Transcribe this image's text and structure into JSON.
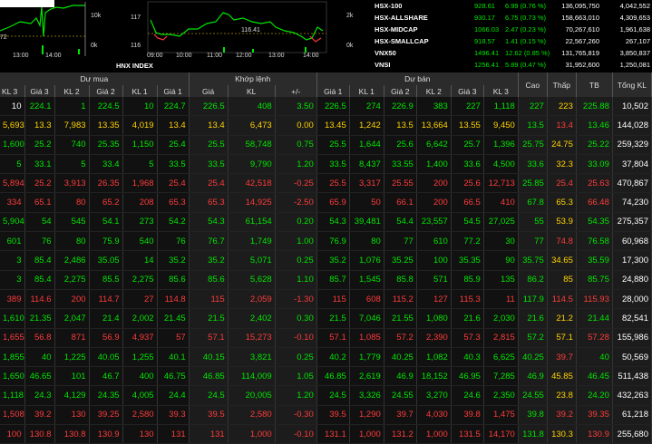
{
  "colors": {
    "up": "#00e600",
    "down": "#ff3b3b",
    "ref": "#ffd400",
    "ceil": "#ff4df0",
    "floor": "#3ee8ff",
    "header_bg": "#2b2b2b"
  },
  "chart1": {
    "y_labels": [
      "10k",
      "0k"
    ],
    "left_text": "72",
    "x_labels": [
      "13:00",
      "14:00"
    ]
  },
  "chart2": {
    "y_left": [
      "117",
      "116"
    ],
    "y_right": [
      "2k",
      "0k"
    ],
    "mid_label": "116.41",
    "x_labels": [
      "09:00",
      "10:00",
      "11:00",
      "12:00",
      "13:00",
      "14:00"
    ],
    "title": "HNX INDEX"
  },
  "indices": [
    {
      "name": "HSX-100",
      "value": "928.61",
      "change": "6.99 (0.76 %)",
      "vol": "136,095,750",
      "val": "4,042,552"
    },
    {
      "name": "HSX-ALLSHARE",
      "value": "930.17",
      "change": "6.75 (0.73 %)",
      "vol": "158,663,010",
      "val": "4,309,653"
    },
    {
      "name": "HSX-MIDCAP",
      "value": "1066.03",
      "change": "2.47 (0.23 %)",
      "vol": "70,267,610",
      "val": "1,961,638"
    },
    {
      "name": "HSX-SMALLCAP",
      "value": "918.57",
      "change": "1.41 (0.15 %)",
      "vol": "22,567,260",
      "val": "267,107"
    },
    {
      "name": "VNX50",
      "value": "1496.41",
      "change": "12.62 (0.85 %)",
      "vol": "131,765,819",
      "val": "3,850,837"
    },
    {
      "name": "VNSI",
      "value": "1256.41",
      "change": "5.89 (0.47 %)",
      "vol": "31,952,600",
      "val": "1,250,081"
    }
  ],
  "headers": {
    "groups": [
      "Dư mua",
      "Khớp lệnh",
      "Dư bán"
    ],
    "cols": [
      "KL 3",
      "Giá 3",
      "KL 2",
      "Giá 2",
      "KL 1",
      "Giá 1",
      "Giá",
      "KL",
      "+/-",
      "Giá 1",
      "KL 1",
      "Giá 2",
      "KL 2",
      "Giá 3",
      "KL 3",
      "Cao",
      "Thấp",
      "TB",
      "Tổng KL"
    ]
  },
  "rows": [
    [
      "10",
      "224.1",
      "1",
      "224.5",
      "10",
      "224.7",
      "226.5",
      "408",
      "3.50",
      "226.5",
      "274",
      "226.9",
      "383",
      "227",
      "1,118",
      "227",
      "223",
      "225.88",
      "10,502"
    ],
    [
      "5,693",
      "13.3",
      "7,983",
      "13.35",
      "4,019",
      "13.4",
      "13.4",
      "6,473",
      "0.00",
      "13.45",
      "1,242",
      "13.5",
      "13,664",
      "13.55",
      "9,450",
      "13.5",
      "13.4",
      "13.46",
      "144,028"
    ],
    [
      "1,600",
      "25.2",
      "740",
      "25.35",
      "1,150",
      "25.4",
      "25.5",
      "58,748",
      "0.75",
      "25.5",
      "1,644",
      "25.6",
      "6,642",
      "25.7",
      "1,396",
      "25.75",
      "24.75",
      "25.22",
      "259,329"
    ],
    [
      "5",
      "33.1",
      "5",
      "33.4",
      "5",
      "33.5",
      "33.5",
      "9,790",
      "1.20",
      "33.5",
      "8,437",
      "33.55",
      "1,400",
      "33.6",
      "4,500",
      "33.6",
      "32.3",
      "33.09",
      "37,804"
    ],
    [
      "5,894",
      "25.2",
      "3,913",
      "26.35",
      "1,968",
      "25.4",
      "25.4",
      "42,518",
      "-0.25",
      "25.5",
      "3,317",
      "25.55",
      "200",
      "25.6",
      "12,713",
      "25.85",
      "25.4",
      "25.63",
      "470,867"
    ],
    [
      "334",
      "65.1",
      "80",
      "65.2",
      "208",
      "65.3",
      "65.3",
      "14,925",
      "-2.50",
      "65.9",
      "50",
      "66.1",
      "200",
      "66.5",
      "410",
      "67.8",
      "65.3",
      "66.48",
      "74,230"
    ],
    [
      "5,904",
      "54",
      "545",
      "54.1",
      "273",
      "54.2",
      "54.3",
      "61,154",
      "0.20",
      "54.3",
      "39,481",
      "54.4",
      "23,557",
      "54.5",
      "27,025",
      "55",
      "53.9",
      "54.35",
      "275,357"
    ],
    [
      "601",
      "76",
      "80",
      "75.9",
      "540",
      "76",
      "76.7",
      "1,749",
      "1.00",
      "76.9",
      "80",
      "77",
      "610",
      "77.2",
      "30",
      "77",
      "74.8",
      "76.58",
      "60,968"
    ],
    [
      "3",
      "85.4",
      "2,486",
      "35.05",
      "14",
      "35.2",
      "35.2",
      "5,071",
      "0.25",
      "35.2",
      "1,076",
      "35.25",
      "100",
      "35.35",
      "90",
      "35.75",
      "34.65",
      "35.59",
      "17,300"
    ],
    [
      "3",
      "85.4",
      "2,275",
      "85.5",
      "2,275",
      "85.6",
      "85.6",
      "5,628",
      "1.10",
      "85.7",
      "1,545",
      "85.8",
      "571",
      "85.9",
      "135",
      "86.2",
      "85",
      "85.75",
      "24,880"
    ],
    [
      "389",
      "114.6",
      "200",
      "114.7",
      "27",
      "114.8",
      "115",
      "2,059",
      "-1.30",
      "115",
      "608",
      "115.2",
      "127",
      "115.3",
      "11",
      "117.9",
      "114.5",
      "115.93",
      "28,000"
    ],
    [
      "1,610",
      "21.35",
      "2,047",
      "21.4",
      "2,002",
      "21.45",
      "21.5",
      "2,402",
      "0.30",
      "21.5",
      "7,046",
      "21.55",
      "1,080",
      "21.6",
      "2,030",
      "21.6",
      "21.2",
      "21.44",
      "82,541"
    ],
    [
      "1,655",
      "56.8",
      "871",
      "56.9",
      "4,937",
      "57",
      "57.1",
      "15,273",
      "-0.10",
      "57.1",
      "1,085",
      "57.2",
      "2,390",
      "57.3",
      "2,815",
      "57.2",
      "57.1",
      "57.28",
      "155,986"
    ],
    [
      "1,855",
      "40",
      "1,225",
      "40.05",
      "1,255",
      "40.1",
      "40.15",
      "3,821",
      "0.25",
      "40.2",
      "1,779",
      "40.25",
      "1,082",
      "40.3",
      "6,625",
      "40.25",
      "39.7",
      "40",
      "50,569"
    ],
    [
      "1,650",
      "46.65",
      "101",
      "46.7",
      "400",
      "46.75",
      "46.85",
      "114,009",
      "1.05",
      "46.85",
      "2,619",
      "46.9",
      "18,152",
      "46.95",
      "7,285",
      "46.9",
      "45.85",
      "46.45",
      "511,438"
    ],
    [
      "1,118",
      "24.3",
      "4,129",
      "24.35",
      "4,005",
      "24.4",
      "24.5",
      "20,005",
      "1.20",
      "24.5",
      "3,326",
      "24.55",
      "3,270",
      "24.6",
      "2,350",
      "24.55",
      "23.8",
      "24.20",
      "432,263"
    ],
    [
      "1,508",
      "39.2",
      "130",
      "39.25",
      "2,580",
      "39.3",
      "39.5",
      "2,580",
      "-0.30",
      "39.5",
      "1,290",
      "39.7",
      "4,030",
      "39.8",
      "1,475",
      "39.8",
      "39.2",
      "39.35",
      "61,218"
    ],
    [
      "100",
      "130.8",
      "130.8",
      "130.9",
      "130",
      "131",
      "131",
      "1,000",
      "-0.10",
      "131.1",
      "1,000",
      "131.2",
      "1,000",
      "131.5",
      "14,170",
      "131.8",
      "130.3",
      "130.9",
      "255,680"
    ]
  ]
}
